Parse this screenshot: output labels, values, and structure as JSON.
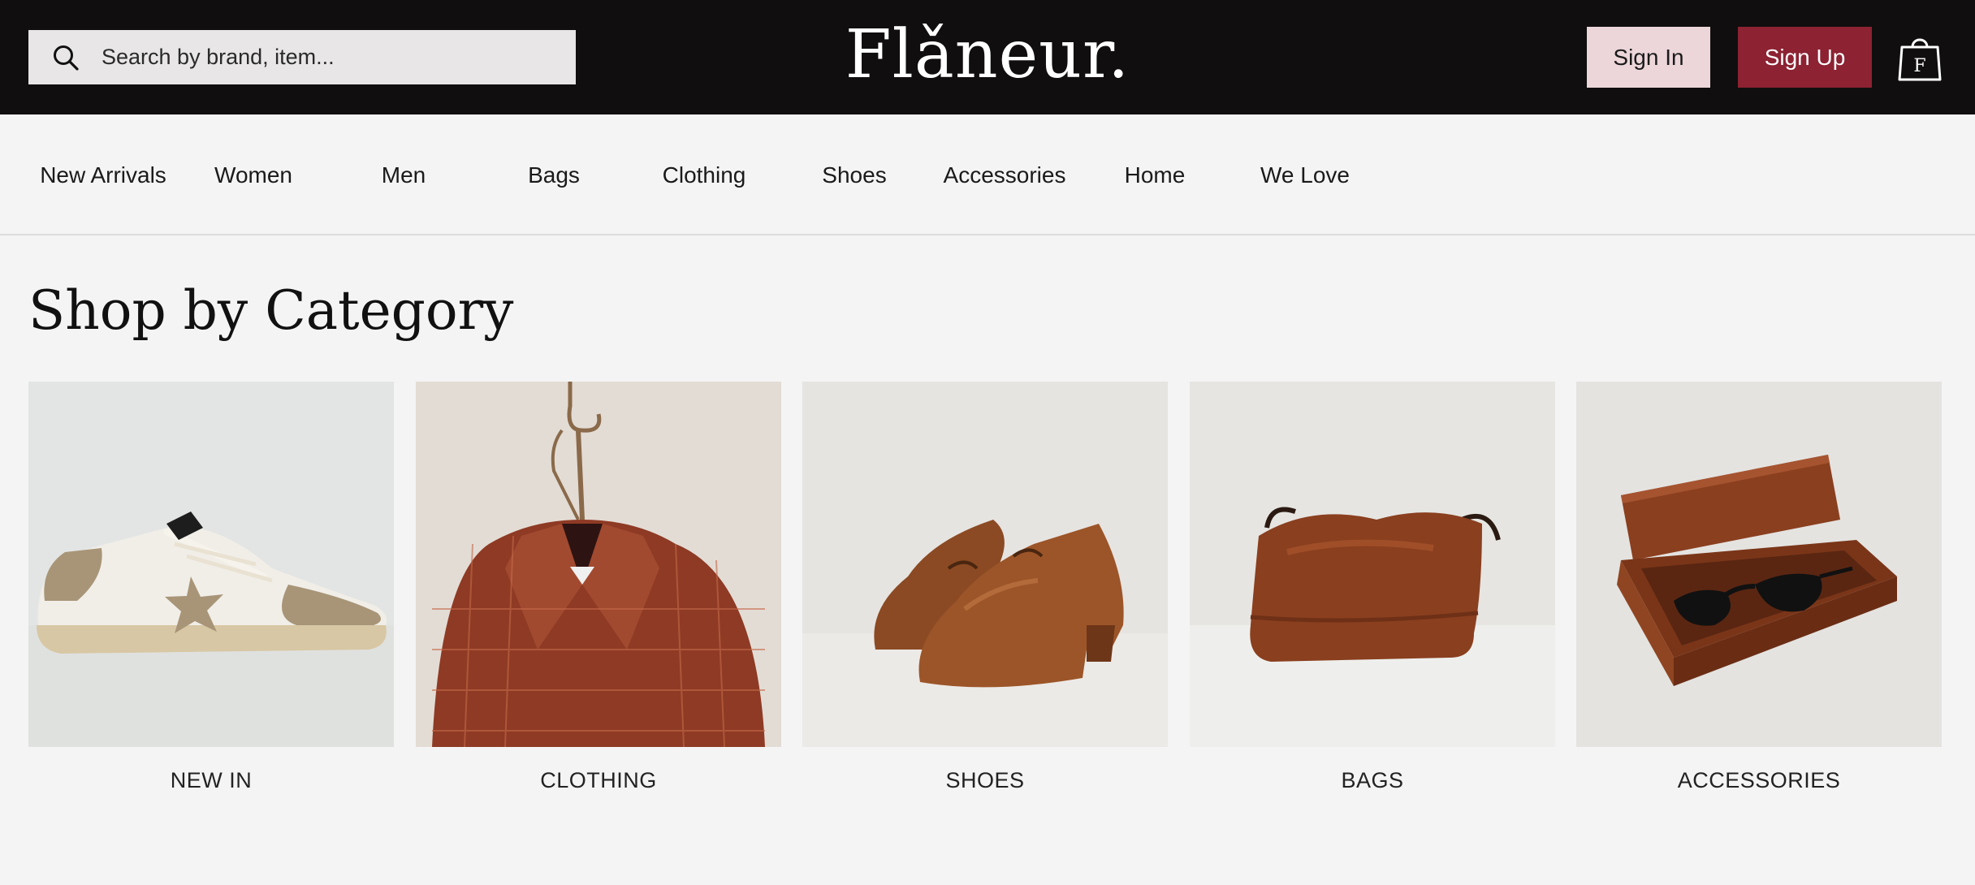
{
  "header": {
    "search_placeholder": "Search by brand, item...",
    "logo": "Flǎneur.",
    "sign_in_label": "Sign In",
    "sign_up_label": "Sign Up",
    "bag_letter": "F"
  },
  "nav": {
    "items": [
      {
        "label": "New Arrivals"
      },
      {
        "label": "Women"
      },
      {
        "label": "Men"
      },
      {
        "label": "Bags"
      },
      {
        "label": "Clothing"
      },
      {
        "label": "Shoes"
      },
      {
        "label": "Accessories"
      },
      {
        "label": "Home"
      },
      {
        "label": "We Love"
      }
    ]
  },
  "section": {
    "title": "Shop by Category"
  },
  "categories": [
    {
      "label": "NEW IN",
      "icon": "sneaker-image"
    },
    {
      "label": "CLOTHING",
      "icon": "leather-jacket-image"
    },
    {
      "label": "SHOES",
      "icon": "ankle-boots-image"
    },
    {
      "label": "BAGS",
      "icon": "leather-bag-image"
    },
    {
      "label": "ACCESSORIES",
      "icon": "sunglasses-case-image"
    }
  ],
  "colors": {
    "header_bg": "#100e0f",
    "sign_in_bg": "#ecd6da",
    "sign_up_bg": "#8c2232",
    "page_bg": "#f4f4f4"
  }
}
